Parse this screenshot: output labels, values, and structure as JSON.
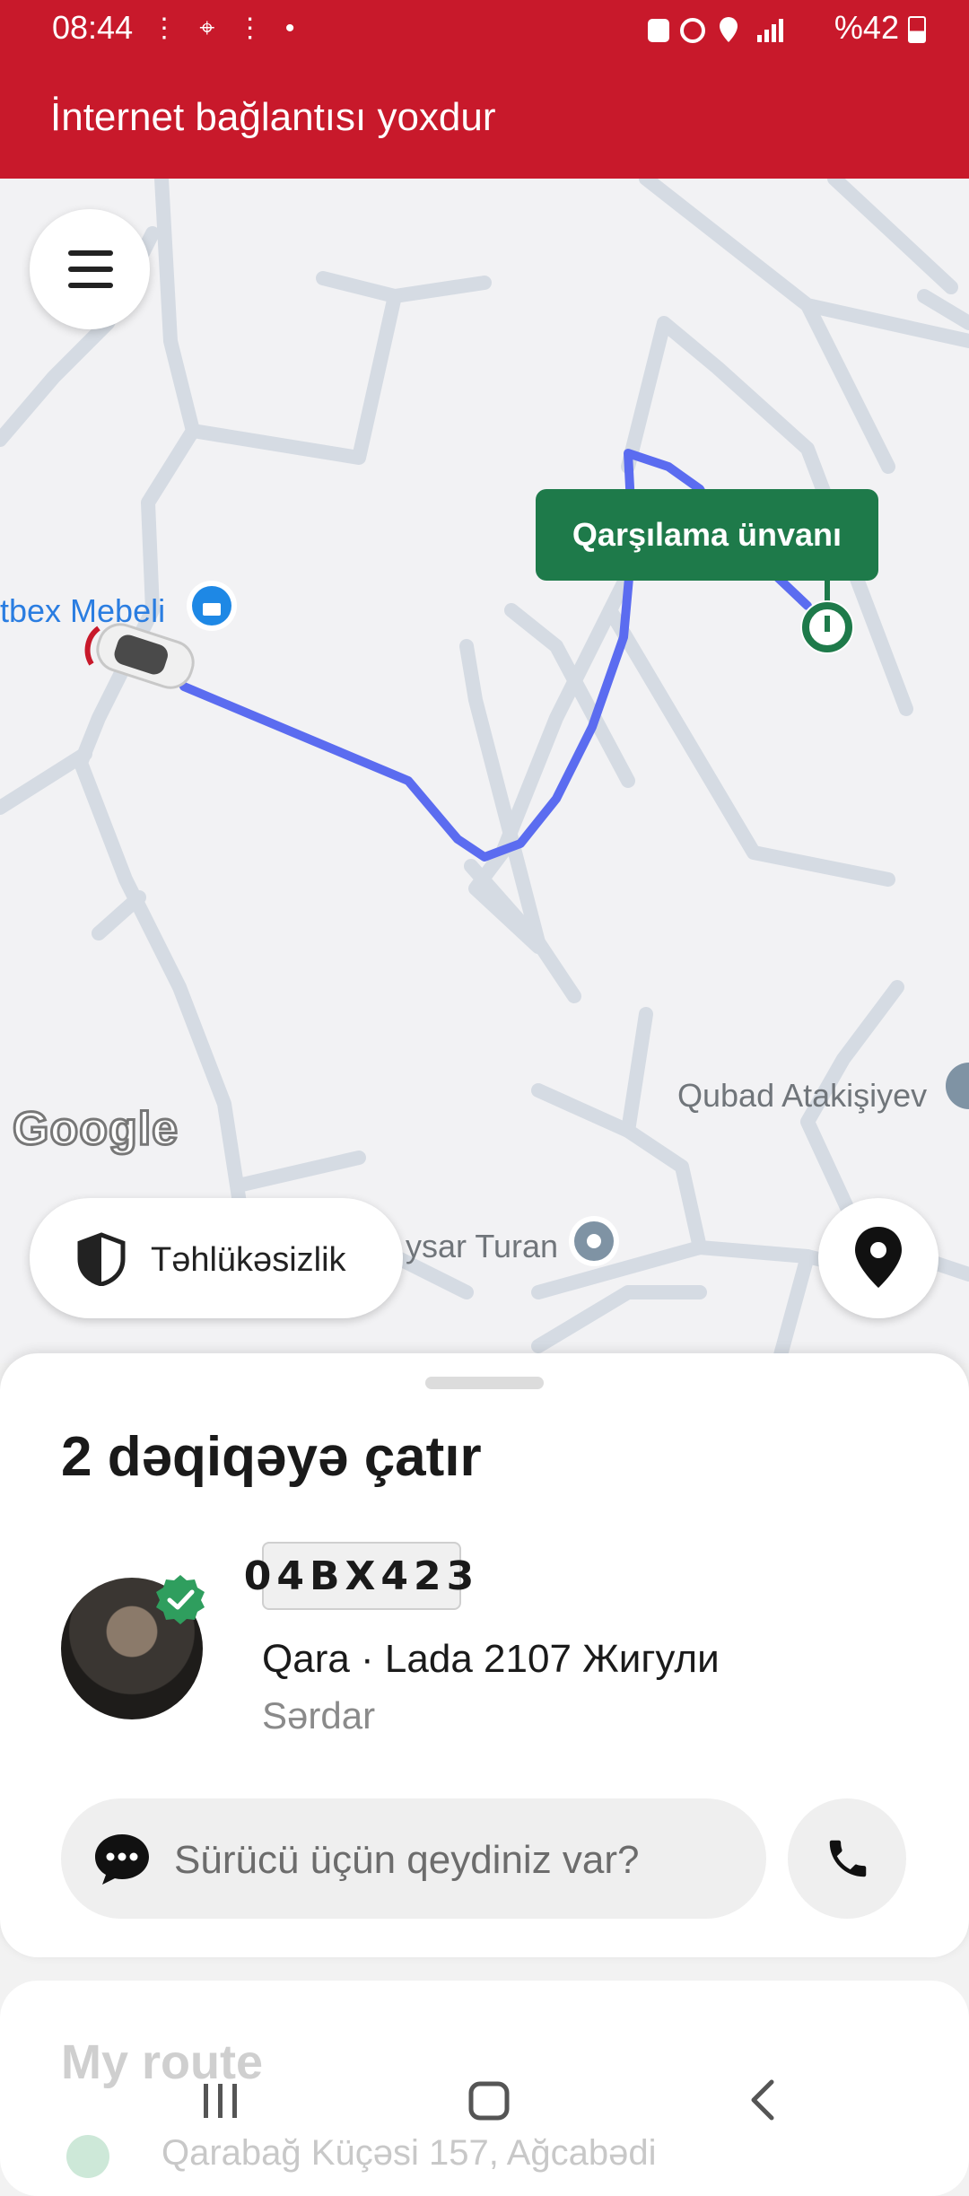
{
  "status_bar": {
    "time": "08:44",
    "battery": "%42",
    "left_icons": [
      "footprints-icon",
      "location-icon",
      "footprints-icon",
      "dot-icon"
    ],
    "right_icons": [
      "alarm-lock-icon",
      "alarm-icon",
      "location-icon",
      "signal-icon",
      "battery-icon"
    ]
  },
  "banner": {
    "text": "İnternet bağlantısı yoxdur"
  },
  "map": {
    "pickup_label": "Qarşılama ünvanı",
    "poi_labels": [
      "tbex Mebeli",
      "Qubad Atakişiyev",
      "ysar Turan"
    ],
    "google_logo": "Google",
    "route_color": "#5b6cf0",
    "pickup_color": "#1e7a4a"
  },
  "safety": {
    "label": "Təhlükəsizlik"
  },
  "sheet": {
    "eta": "2 dəqiqəyə çatır",
    "plate": "04BX423",
    "car": "Qara · Lada 2107 Жигули",
    "driver": "Sərdar",
    "note_placeholder": "Sürücü üçün qeydiniz var?"
  },
  "route_card": {
    "title": "My route",
    "address": "Qarabağ Küçəsi 157, Ağcabədi"
  }
}
